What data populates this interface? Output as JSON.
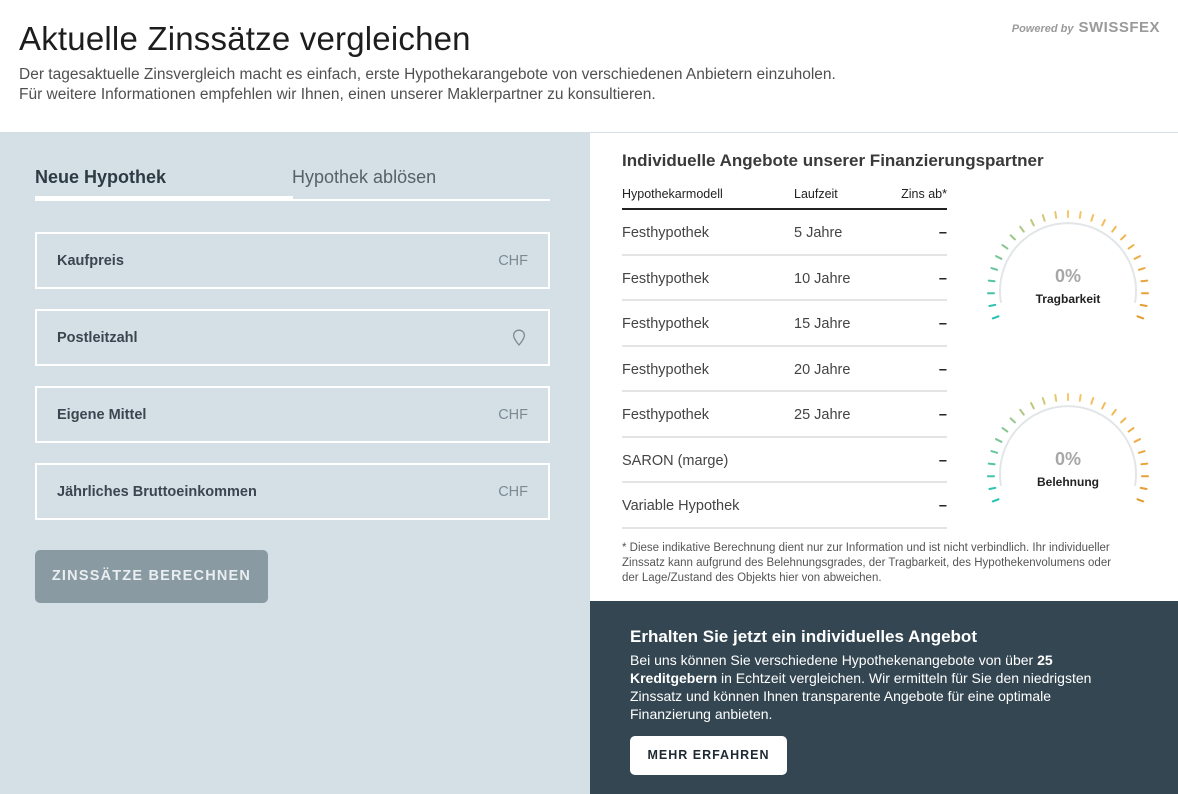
{
  "header": {
    "title": "Aktuelle Zinssätze vergleichen",
    "subtitle": "Der tagesaktuelle Zinsvergleich macht es einfach, erste Hypothekarangebote von verschiedenen Anbietern einzuholen. Für weitere Informationen empfehlen wir Ihnen, einen unserer Maklerpartner zu konsultieren.",
    "powered_by": "Powered by",
    "brand": "SWISSFEX"
  },
  "tabs": {
    "active": "Neue Hypothek",
    "inactive": "Hypothek ablösen"
  },
  "form": {
    "fields": [
      {
        "label": "Kaufpreis",
        "suffix": "CHF"
      },
      {
        "label": "Postleitzahl",
        "icon": "location-pin-icon"
      },
      {
        "label": "Eigene Mittel",
        "suffix": "CHF"
      },
      {
        "label": "Jährliches Bruttoeinkommen",
        "suffix": "CHF"
      }
    ],
    "submit_label": "ZINSSÄTZE BERECHNEN"
  },
  "offers": {
    "title": "Individuelle Angebote unserer Finanzierungspartner",
    "columns": [
      "Hypothekarmodell",
      "Laufzeit",
      "Zins ab*"
    ],
    "rows": [
      {
        "model": "Festhypothek",
        "term": "5 Jahre",
        "rate": "–"
      },
      {
        "model": "Festhypothek",
        "term": "10 Jahre",
        "rate": "–"
      },
      {
        "model": "Festhypothek",
        "term": "15 Jahre",
        "rate": "–"
      },
      {
        "model": "Festhypothek",
        "term": "20 Jahre",
        "rate": "–"
      },
      {
        "model": "Festhypothek",
        "term": "25 Jahre",
        "rate": "–"
      },
      {
        "model": "SARON (marge)",
        "term": "",
        "rate": "–"
      },
      {
        "model": "Variable Hypothek",
        "term": "",
        "rate": "–"
      }
    ],
    "footnote": "* Diese indikative Berechnung dient nur zur Information und ist nicht verbindlich. Ihr individueller Zinssatz kann aufgrund des Belehnungsgrades, der Tragbarkeit, des Hypothekenvolumens oder der Lage/Zustand des Objekts hier von abweichen."
  },
  "gauges": [
    {
      "value": "0%",
      "label": "Tragbarkeit",
      "value_fraction": 0,
      "colors": [
        "#1ec2b4",
        "#f5c86a",
        "#e39a2e"
      ]
    },
    {
      "value": "0%",
      "label": "Belehnung",
      "value_fraction": 0,
      "colors": [
        "#1ec2b4",
        "#f5c86a",
        "#e39a2e"
      ]
    }
  ],
  "promo": {
    "title": "Erhalten Sie jetzt ein individuelles Angebot",
    "text_before": "Bei uns können Sie verschiedene Hypothekenangebote von über ",
    "text_bold": "25 Kreditgebern",
    "text_after": " in Echtzeit vergleichen. Wir ermitteln für Sie den niedrigsten Zinssatz und können Ihnen transparente Angebote für eine optimale Finanzierung anbieten.",
    "button_label": "MEHR ERFAHREN"
  }
}
